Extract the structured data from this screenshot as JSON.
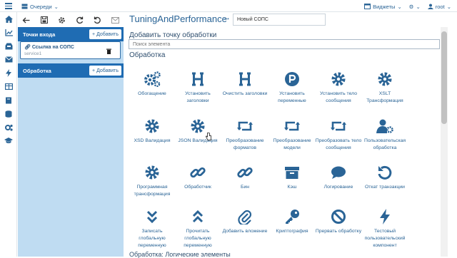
{
  "topbar": {
    "queues_label": "Очереди",
    "widgets_label": "Виджеты",
    "user_label": "root"
  },
  "toolbar": {
    "icons": [
      "back-arrow-icon",
      "save-icon",
      "gear-icon",
      "sync-icon",
      "refresh-icon",
      "mail-icon"
    ]
  },
  "breadcrumb": {
    "project": "TuningAndPerformance",
    "current_value": "Новый СОПС"
  },
  "sidebar": {
    "entry_points_title": "Точки входа",
    "add_label": "+ Добавить",
    "entry": {
      "title": "Ссылка на СОПС",
      "subtitle": "service1"
    },
    "processing_title": "Обработка",
    "processing_add_label": "+ Добавить"
  },
  "panel": {
    "title": "Добавить точку обработки",
    "search_placeholder": "Поиск элемента",
    "section_title": "Обработка",
    "section2_title": "Обработка: Логические элементы"
  },
  "tiles": [
    {
      "label": "Обогащение",
      "icon": "cogs-icon"
    },
    {
      "label": "Установить заголовки",
      "icon": "header-icon"
    },
    {
      "label": "Очистить заголовки",
      "icon": "header-icon"
    },
    {
      "label": "Установить переменные",
      "icon": "p-circle-icon"
    },
    {
      "label": "Установить тело сообщения",
      "icon": "gear-icon"
    },
    {
      "label": "XSLT Трансформация",
      "icon": "gear-icon"
    },
    {
      "label": "XSD Валидация",
      "icon": "gear-icon"
    },
    {
      "label": "JSON Валидация",
      "icon": "gear-icon"
    },
    {
      "label": "Преобразование форматов",
      "icon": "retweet-icon"
    },
    {
      "label": "Преобразование модели",
      "icon": "retweet-icon"
    },
    {
      "label": "Преобразовать тело сообщения",
      "icon": "retweet-icon"
    },
    {
      "label": "Пользовательская обработка",
      "icon": "user-gear-icon"
    },
    {
      "label": "Программная трансформация",
      "icon": "gear-icon"
    },
    {
      "label": "Обработчик",
      "icon": "link-icon"
    },
    {
      "label": "Бин",
      "icon": "link-icon"
    },
    {
      "label": "Кэш",
      "icon": "archive-icon"
    },
    {
      "label": "Логирование",
      "icon": "comment-icon"
    },
    {
      "label": "Откат транзакции",
      "icon": "undo-icon"
    },
    {
      "label": "Записать глобальную переменную",
      "icon": "chevrons-down-icon"
    },
    {
      "label": "Прочитать глобальную переменную",
      "icon": "chevrons-up-icon"
    },
    {
      "label": "Добавить вложение",
      "icon": "paperclip-icon"
    },
    {
      "label": "Криптография",
      "icon": "key-icon"
    },
    {
      "label": "Прервать обработку",
      "icon": "ban-icon"
    },
    {
      "label": "Тестовый пользовательский компонент",
      "icon": "bolt-icon"
    }
  ],
  "nav": {
    "icons": [
      "home-icon",
      "chart-icon",
      "inbox-icon",
      "mail-icon",
      "bolt-icon",
      "table-icon",
      "book-icon",
      "database-icon",
      "cogs-icon",
      "graduation-icon"
    ]
  },
  "colors": {
    "accent": "#1f6cb3",
    "icon_blue": "#2a6496",
    "sidebar_bg": "#bfdcf2"
  }
}
